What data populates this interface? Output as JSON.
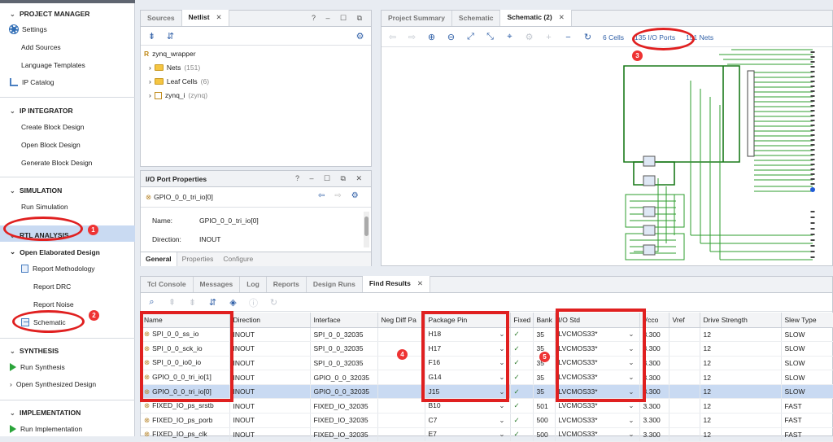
{
  "nav": {
    "project_manager": "PROJECT MANAGER",
    "settings": "Settings",
    "add_sources": "Add Sources",
    "language_templates": "Language Templates",
    "ip_catalog": "IP Catalog",
    "ip_integrator": "IP INTEGRATOR",
    "create_block_design": "Create Block Design",
    "open_block_design": "Open Block Design",
    "generate_block_design": "Generate Block Design",
    "simulation": "SIMULATION",
    "run_simulation": "Run Simulation",
    "rtl_analysis": "RTL ANALYSIS",
    "open_elaborated_design": "Open Elaborated Design",
    "report_methodology": "Report Methodology",
    "report_drc": "Report DRC",
    "report_noise": "Report Noise",
    "schematic": "Schematic",
    "synthesis": "SYNTHESIS",
    "run_synthesis": "Run Synthesis",
    "open_synthesized_design": "Open Synthesized Design",
    "implementation": "IMPLEMENTATION",
    "run_implementation": "Run Implementation"
  },
  "annotations": {
    "b1": "1",
    "b2": "2",
    "b3": "3",
    "b4": "4",
    "b5": "5"
  },
  "sources": {
    "tab_sources": "Sources",
    "tab_netlist": "Netlist",
    "win_buttons": "? – ☐ ⧉",
    "root": "zynq_wrapper",
    "nets": "Nets",
    "nets_count": "(151)",
    "leaf_cells": "Leaf Cells",
    "leaf_count": "(6)",
    "zynq_i": "zynq_i",
    "zynq_i_sub": "(zynq)"
  },
  "props": {
    "title": "I/O Port Properties",
    "win_buttons": "? – ☐ ⧉ ✕",
    "port": "GPIO_0_0_tri_io[0]",
    "name_label": "Name:",
    "name_value": "GPIO_0_0_tri_io[0]",
    "direction_label": "Direction:",
    "direction_value": "INOUT",
    "tab_general": "General",
    "tab_properties": "Properties",
    "tab_configure": "Configure"
  },
  "schem": {
    "tab_summary": "Project Summary",
    "tab_schematic": "Schematic",
    "tab_schematic2": "Schematic (2)",
    "cells": "6 Cells",
    "io_ports": "135 I/O Ports",
    "nets": "151 Nets"
  },
  "bottom": {
    "tabs": [
      "Tcl Console",
      "Messages",
      "Log",
      "Reports",
      "Design Runs",
      "Find Results"
    ],
    "columns": [
      "Name",
      "Direction",
      "Interface",
      "Neg Diff Pa",
      "Package Pin",
      "Fixed",
      "Bank",
      "I/O Std",
      "Vcco",
      "Vref",
      "Drive Strength",
      "Slew Type"
    ],
    "rows": [
      {
        "name": "SPI_0_0_ss_io",
        "dir": "INOUT",
        "iface": "SPI_0_0_32035",
        "neg": "",
        "pin": "H18",
        "fixed": "✓",
        "bank": "35",
        "std": "LVCMOS33*",
        "vcco": "3.300",
        "vref": "",
        "drive": "12",
        "slew": "SLOW"
      },
      {
        "name": "SPI_0_0_sck_io",
        "dir": "INOUT",
        "iface": "SPI_0_0_32035",
        "neg": "",
        "pin": "H17",
        "fixed": "✓",
        "bank": "35",
        "std": "LVCMOS33*",
        "vcco": "3.300",
        "vref": "",
        "drive": "12",
        "slew": "SLOW"
      },
      {
        "name": "SPI_0_0_io0_io",
        "dir": "INOUT",
        "iface": "SPI_0_0_32035",
        "neg": "",
        "pin": "F16",
        "fixed": "✓",
        "bank": "35",
        "std": "LVCMOS33*",
        "vcco": "3.300",
        "vref": "",
        "drive": "12",
        "slew": "SLOW"
      },
      {
        "name": "GPIO_0_0_tri_io[1]",
        "dir": "INOUT",
        "iface": "GPIO_0_0_32035",
        "neg": "",
        "pin": "G14",
        "fixed": "✓",
        "bank": "35",
        "std": "LVCMOS33*",
        "vcco": "3.300",
        "vref": "",
        "drive": "12",
        "slew": "SLOW"
      },
      {
        "name": "GPIO_0_0_tri_io[0]",
        "dir": "INOUT",
        "iface": "GPIO_0_0_32035",
        "neg": "",
        "pin": "J15",
        "fixed": "✓",
        "bank": "35",
        "std": "LVCMOS33*",
        "vcco": "3.300",
        "vref": "",
        "drive": "12",
        "slew": "SLOW"
      },
      {
        "name": "FIXED_IO_ps_srstb",
        "dir": "INOUT",
        "iface": "FIXED_IO_32035",
        "neg": "",
        "pin": "B10",
        "fixed": "✓",
        "bank": "501",
        "std": "LVCMOS33*",
        "vcco": "3.300",
        "vref": "",
        "drive": "12",
        "slew": "FAST"
      },
      {
        "name": "FIXED_IO_ps_porb",
        "dir": "INOUT",
        "iface": "FIXED_IO_32035",
        "neg": "",
        "pin": "C7",
        "fixed": "✓",
        "bank": "500",
        "std": "LVCMOS33*",
        "vcco": "3.300",
        "vref": "",
        "drive": "12",
        "slew": "FAST"
      },
      {
        "name": "FIXED_IO_ps_clk",
        "dir": "INOUT",
        "iface": "FIXED_IO_32035",
        "neg": "",
        "pin": "E7",
        "fixed": "✓",
        "bank": "500",
        "std": "LVCMOS33*",
        "vcco": "3.300",
        "vref": "",
        "drive": "12",
        "slew": "FAST"
      }
    ]
  }
}
